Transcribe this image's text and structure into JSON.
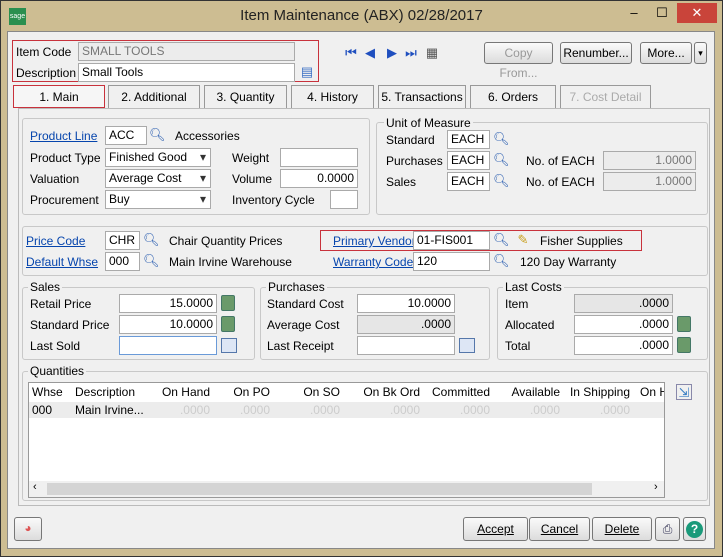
{
  "window": {
    "title": "Item Maintenance (ABX) 02/28/2017",
    "logo": "sage"
  },
  "header": {
    "item_code_label": "Item Code",
    "item_code": "SMALL TOOLS",
    "description_label": "Description",
    "description": "Small Tools",
    "copy_from": "Copy From...",
    "renumber": "Renumber...",
    "more": "More..."
  },
  "tabs": [
    "1. Main",
    "2. Additional",
    "3. Quantity",
    "4. History",
    "5. Transactions",
    "6. Orders",
    "7. Cost Detail"
  ],
  "main": {
    "product_line_label": "Product Line",
    "product_line": "ACC",
    "product_line_desc": "Accessories",
    "product_type_label": "Product Type",
    "product_type": "Finished Good",
    "valuation_label": "Valuation",
    "valuation": "Average Cost",
    "procurement_label": "Procurement",
    "procurement": "Buy",
    "weight_label": "Weight",
    "weight": "",
    "volume_label": "Volume",
    "volume": "0.0000",
    "inventory_cycle_label": "Inventory Cycle",
    "inventory_cycle": "",
    "uom": {
      "title": "Unit of Measure",
      "standard_label": "Standard",
      "standard": "EACH",
      "purchases_label": "Purchases",
      "purchases": "EACH",
      "sales_label": "Sales",
      "sales": "EACH",
      "no_of_label": "No. of  EACH",
      "purchases_factor": "1.0000",
      "sales_factor": "1.0000"
    },
    "price_code_label": "Price Code",
    "price_code": "CHR",
    "price_code_desc": "Chair Quantity Prices",
    "default_whse_label": "Default Whse",
    "default_whse": "000",
    "default_whse_desc": "Main  Irvine Warehouse",
    "primary_vendor_label": "Primary Vendor",
    "primary_vendor": "01-FIS001",
    "primary_vendor_desc": "Fisher Supplies",
    "warranty_code_label": "Warranty Code",
    "warranty_code": "120",
    "warranty_desc": "120 Day Warranty"
  },
  "sales": {
    "title": "Sales",
    "retail_price_label": "Retail Price",
    "retail_price": "15.0000",
    "standard_price_label": "Standard Price",
    "standard_price": "10.0000",
    "last_sold_label": "Last Sold",
    "last_sold": ""
  },
  "purchases": {
    "title": "Purchases",
    "standard_cost_label": "Standard Cost",
    "standard_cost": "10.0000",
    "average_cost_label": "Average Cost",
    "average_cost": ".0000",
    "last_receipt_label": "Last Receipt",
    "last_receipt": ""
  },
  "last_costs": {
    "title": "Last Costs",
    "item_label": "Item",
    "item": ".0000",
    "allocated_label": "Allocated",
    "allocated": ".0000",
    "total_label": "Total",
    "total": ".0000"
  },
  "quantities": {
    "title": "Quantities",
    "columns": [
      "Whse",
      "Description",
      "On Hand",
      "On PO",
      "On SO",
      "On Bk Ord",
      "Committed",
      "Available",
      "In Shipping",
      "On H"
    ],
    "rows": [
      [
        "000",
        "Main  Irvine...",
        ".0000",
        ".0000",
        ".0000",
        ".0000",
        ".0000",
        ".0000",
        ".0000",
        ""
      ]
    ]
  },
  "footer": {
    "accept": "Accept",
    "cancel": "Cancel",
    "delete": "Delete"
  }
}
